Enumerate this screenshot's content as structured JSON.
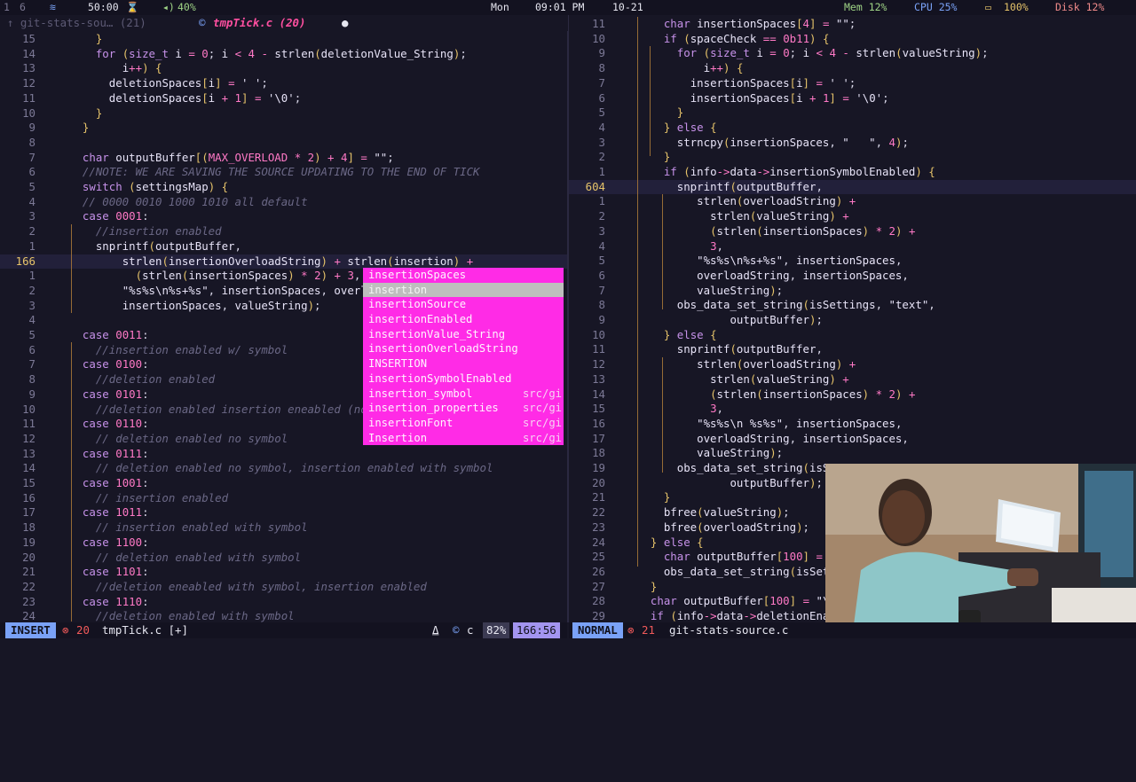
{
  "topbar": {
    "workspace_1": "1",
    "workspace_6": "6",
    "wifi_icon": "≋",
    "volume_icon": "◂)",
    "volume": "40%",
    "timer": "50:00",
    "hourglass_icon": "⌛",
    "day": "Mon",
    "time": "09:01 PM",
    "date": "10-21",
    "mem": "Mem 12%",
    "cpu": "CPU 25%",
    "battery_icon": "▭",
    "battery": "100%",
    "disk": "Disk 12%"
  },
  "tabs": [
    {
      "name": "git-stats-sou…",
      "count": "(21)",
      "state": "inactive"
    },
    {
      "name": "tmpTick.c",
      "count": "(20)",
      "state": "active"
    }
  ],
  "popup": {
    "items": [
      {
        "label": "insertionSpaces",
        "src": ""
      },
      {
        "label": "insertion",
        "src": ""
      },
      {
        "label": "insertionSource",
        "src": ""
      },
      {
        "label": "insertionEnabled",
        "src": ""
      },
      {
        "label": "insertionValue_String",
        "src": ""
      },
      {
        "label": "insertionOverloadString",
        "src": ""
      },
      {
        "label": "INSERTION",
        "src": ""
      },
      {
        "label": "insertionSymbolEnabled",
        "src": ""
      },
      {
        "label": "insertion_symbol",
        "src": "src/gi"
      },
      {
        "label": "insertion_properties",
        "src": "src/gi"
      },
      {
        "label": "insertionFont",
        "src": "src/gi"
      },
      {
        "label": "Insertion",
        "src": "src/gi"
      }
    ]
  },
  "status_left": {
    "mode": "INSERT",
    "error_icon": "⊗",
    "errors": "20",
    "file": "tmpTick.c [+]",
    "lang_icon": "⍙",
    "lang": "c",
    "percent": "82%",
    "position": "166:56"
  },
  "status_right": {
    "mode": "NORMAL",
    "error_icon": "⊗",
    "errors": "21",
    "file": "git-stats-source.c"
  },
  "colors": {
    "background": "#171625",
    "popup": "#ff2be6",
    "keyword": "#c792ea",
    "accent": "#ff79c6",
    "comment": "#6b6886",
    "mode": "#7aa2f7"
  }
}
